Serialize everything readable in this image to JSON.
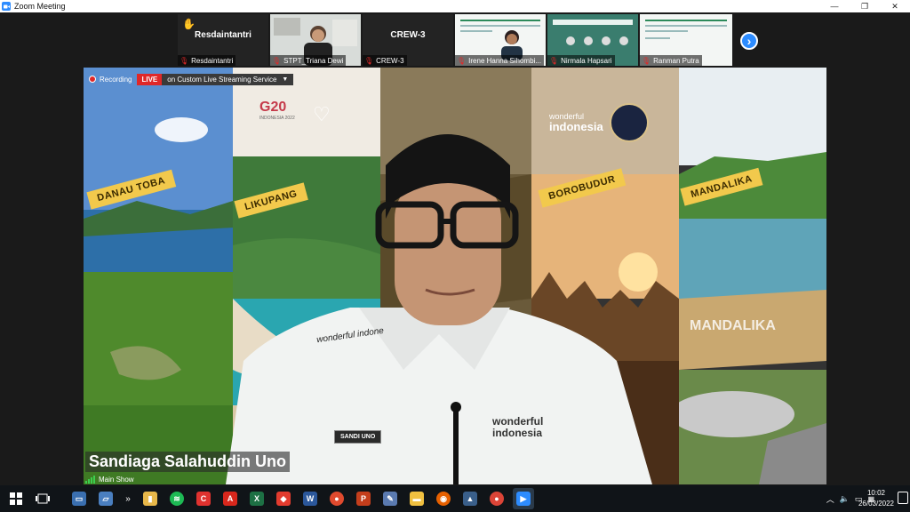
{
  "window": {
    "title": "Zoom Meeting",
    "controls": {
      "minimize": "—",
      "restore": "❐",
      "close": "✕"
    }
  },
  "participants": [
    {
      "display": "Resdaintantri",
      "name": "Resdaintantri",
      "hand_raised": true
    },
    {
      "display": "",
      "name": "STPT_Triana Dewi",
      "hand_raised": false
    },
    {
      "display": "CREW-3",
      "name": "CREW-3",
      "hand_raised": false
    },
    {
      "display": "",
      "name": "Irene Hanna Sihombi...",
      "hand_raised": false
    },
    {
      "display": "",
      "name": "Nirmala Hapsari",
      "hand_raised": false
    },
    {
      "display": "",
      "name": "Ranman Putra",
      "hand_raised": false
    }
  ],
  "recording": {
    "label": "Recording",
    "live_badge": "LIVE",
    "service": "on Custom Live Streaming Service"
  },
  "banners": [
    {
      "label": "DANAU TOBA"
    },
    {
      "label": "LIKUPANG"
    },
    {
      "label": ""
    },
    {
      "label": "BOROBUDUR"
    },
    {
      "label": "MANDALIKA"
    }
  ],
  "stage_text": {
    "g20": "G20",
    "g20_sub": "INDONESIA 2022",
    "wonderful": "wonderful",
    "indonesia": "indonesia",
    "name_tag": "SANDI UNO",
    "shirt_logo": "wonderful indonesia",
    "shirt_top": "wonderful indone",
    "mandalika_sign": "MANDALIKA"
  },
  "speaker": {
    "name": "Sandiaga Salahuddin Uno",
    "view_label": "Main Show"
  },
  "taskbar": {
    "time": "10:02",
    "date": "26/03/2022"
  },
  "colors": {
    "zoom_blue": "#2D8CFF",
    "live_red": "#E02828",
    "banner_yellow": "#F2C94C"
  }
}
